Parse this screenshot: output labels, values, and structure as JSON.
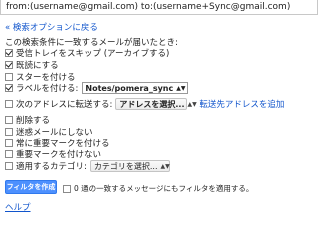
{
  "search": {
    "query": "from:(username@gmail.com) to:(username+Sync@gmail.com)"
  },
  "back_link": "« 検索オプションに戻る",
  "heading": "この検索条件に一致するメールが届いたとき:",
  "options": [
    {
      "label": "受信トレイをスキップ (アーカイブする)",
      "checked": true
    },
    {
      "label": "既読にする",
      "checked": true
    },
    {
      "label": "スターを付ける",
      "checked": false
    },
    {
      "label": "ラベルを付ける:",
      "checked": true,
      "select_value": "Notes/pomera_sync"
    },
    {
      "label": "次のアドレスに転送する:",
      "checked": false,
      "select_value": "アドレスを選択...",
      "extra_link": "転送先アドレスを追加"
    },
    {
      "label": "削除する",
      "checked": false
    },
    {
      "label": "迷惑メールにしない",
      "checked": false
    },
    {
      "label": "常に重要マークを付ける",
      "checked": false
    },
    {
      "label": "重要マークを付けない",
      "checked": false
    },
    {
      "label": "適用するカテゴリ:",
      "checked": false,
      "select_value": "カテゴリを選択..."
    }
  ],
  "create_button": "フィルタを作成",
  "apply_existing": {
    "label": "0 通の一致するメッセージにもフィルタを適用する。",
    "checked": false
  },
  "help": "ヘルプ"
}
